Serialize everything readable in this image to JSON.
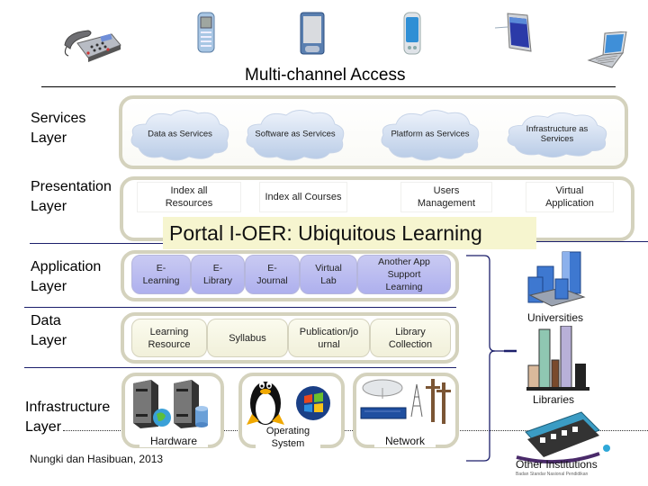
{
  "header": {
    "title": "Multi-channel Access",
    "devices": [
      "desk-phone",
      "mobile-phone",
      "pda",
      "smartphone",
      "tablet",
      "laptop"
    ]
  },
  "layers": {
    "services": "Services\nLayer",
    "services_l1": "Services",
    "services_l2": "Layer",
    "presentation_l1": "Presentation",
    "presentation_l2": "Layer",
    "application_l1": "Application",
    "application_l2": "Layer",
    "data_l1": "Data",
    "data_l2": "Layer",
    "infrastructure_l1": "Infrastructure",
    "infrastructure_l2": "Layer"
  },
  "services": [
    {
      "label": "Data as Services"
    },
    {
      "label": "Software as Services"
    },
    {
      "label": "Platform as Services"
    },
    {
      "label": "Infrastructure as Services"
    }
  ],
  "presentation": [
    {
      "line1": "Index all",
      "line2": "Resources"
    },
    {
      "line1": "Index all Courses",
      "line2": ""
    },
    {
      "line1": "Users",
      "line2": "Management"
    },
    {
      "line1": "Virtual",
      "line2": "Application"
    }
  ],
  "portal_title": "Portal I-OER: Ubiquitous Learning",
  "application": [
    {
      "line1": "E-",
      "line2": "Learning"
    },
    {
      "line1": "E-",
      "line2": "Library"
    },
    {
      "line1": "E-",
      "line2": "Journal"
    },
    {
      "line1": "Virtual",
      "line2": "Lab"
    },
    {
      "line1": "Another App",
      "line2": "Support",
      "line3": "Learning"
    }
  ],
  "data": [
    {
      "line1": "Learning",
      "line2": "Resource"
    },
    {
      "line1": "Syllabus",
      "line2": ""
    },
    {
      "line1": "Publication/jo",
      "line2": "urnal"
    },
    {
      "line1": "Library",
      "line2": "Collection"
    }
  ],
  "infrastructure": {
    "hardware": "Hardware",
    "os_l1": "Operating",
    "os_l2": "System",
    "network": "Network"
  },
  "institutions": {
    "universities": "Universities",
    "libraries": "Libraries",
    "others": "Other Institutions",
    "others_sub": "Badan Standar Nasional Pendidikan"
  },
  "citation": "Nungki dan Hasibuan, 2013",
  "colors": {
    "frame": "#d4d2bd",
    "app_button": "#b9bbf0",
    "data_button": "#f5f4e0",
    "banner": "#f6f5cf",
    "line": "#1c1f6b"
  }
}
